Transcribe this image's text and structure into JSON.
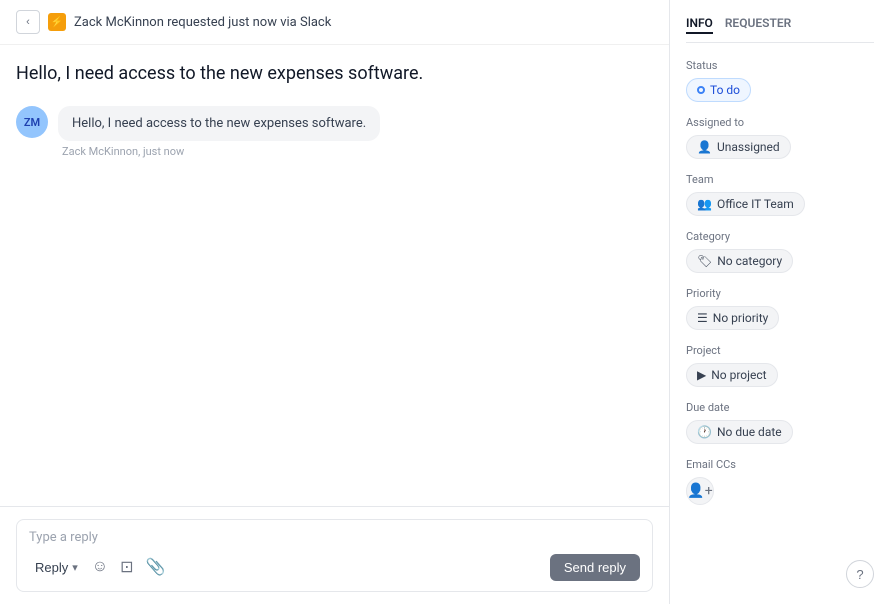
{
  "header": {
    "back_label": "‹",
    "bolt_icon": "⚡",
    "description": "Zack McKinnon requested just now via Slack"
  },
  "conversation": {
    "main_message": "Hello, I need access to the new expenses software.",
    "messages": [
      {
        "avatar_initials": "ZM",
        "bubble_text": "Hello, I need access to the new expenses software.",
        "sender": "Zack McKinnon",
        "timestamp": "just now"
      }
    ]
  },
  "reply_box": {
    "placeholder": "Type a reply",
    "reply_label": "Reply",
    "dropdown_icon": "▾",
    "send_label": "Send reply"
  },
  "right_panel": {
    "tabs": [
      {
        "label": "INFO",
        "active": true
      },
      {
        "label": "REQUESTER",
        "active": false
      }
    ],
    "sections": [
      {
        "label": "Status",
        "type": "status",
        "value": "To do"
      },
      {
        "label": "Assigned to",
        "type": "chip",
        "icon": "👤",
        "value": "Unassigned"
      },
      {
        "label": "Team",
        "type": "chip",
        "icon": "👥",
        "value": "Office IT Team"
      },
      {
        "label": "Category",
        "type": "chip",
        "icon": "🏷",
        "value": "No category"
      },
      {
        "label": "Priority",
        "type": "chip",
        "icon": "☰",
        "value": "No priority"
      },
      {
        "label": "Project",
        "type": "chip",
        "icon": "▶",
        "value": "No project"
      },
      {
        "label": "Due date",
        "type": "chip",
        "icon": "🕐",
        "value": "No due date"
      },
      {
        "label": "Email CCs",
        "type": "add",
        "icon": "👤+"
      }
    ]
  },
  "help": {
    "label": "?"
  }
}
